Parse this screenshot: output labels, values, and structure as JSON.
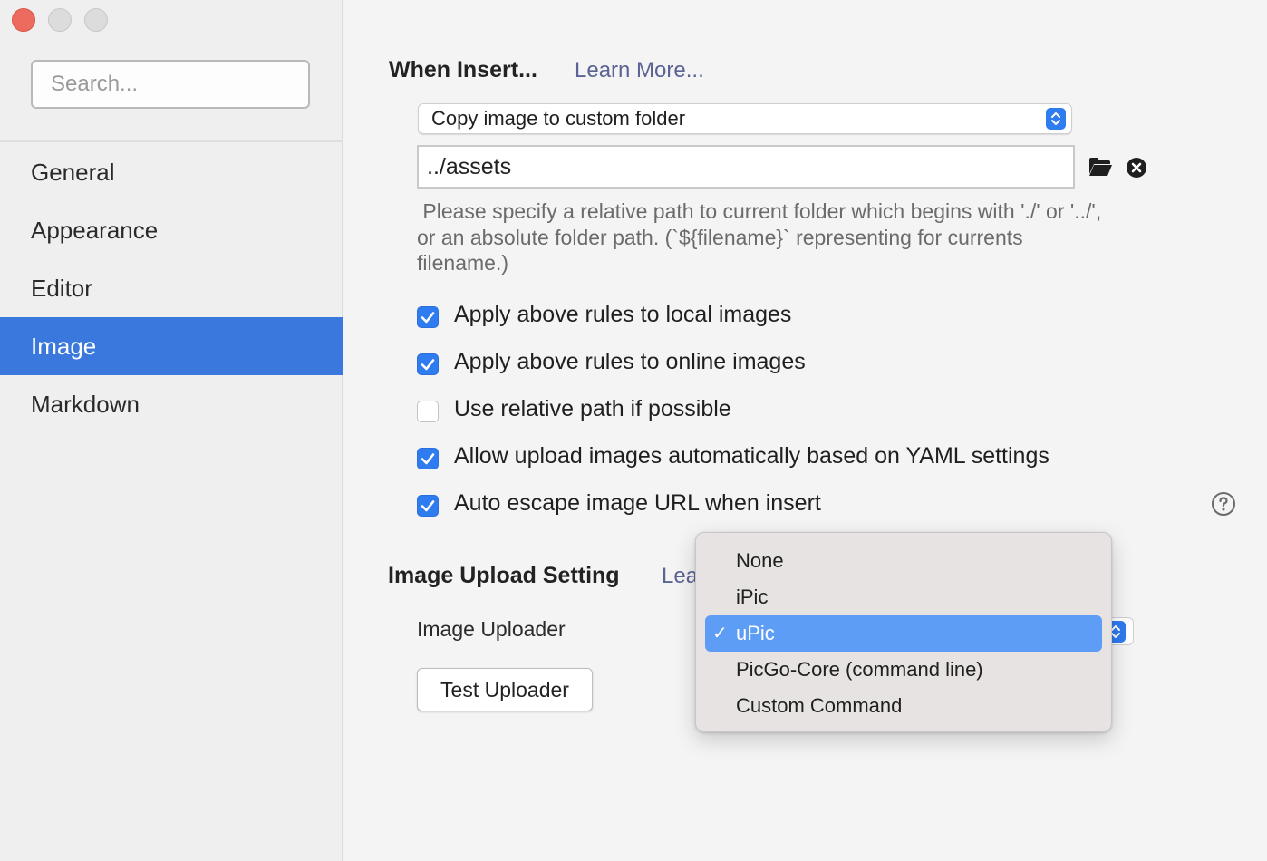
{
  "sidebar": {
    "search_placeholder": "Search...",
    "items": [
      {
        "label": "General"
      },
      {
        "label": "Appearance"
      },
      {
        "label": "Editor"
      },
      {
        "label": "Image",
        "active": true
      },
      {
        "label": "Markdown"
      }
    ]
  },
  "insert": {
    "title": "When Insert...",
    "learn_more": "Learn More...",
    "action_selected": "Copy image to custom folder",
    "folder_value": "../assets",
    "hint_line1": " Please specify a relative path to current folder which begins with './' or '../',",
    "hint_line2": "or an absolute folder path. (`${filename}` representing for currents",
    "hint_line3": "filename.)",
    "options": [
      {
        "label": "Apply above rules to local images",
        "checked": true
      },
      {
        "label": "Apply above rules to online images",
        "checked": true
      },
      {
        "label": "Use relative path if possible",
        "checked": false
      },
      {
        "label": "Allow upload images automatically based on YAML settings",
        "checked": true
      },
      {
        "label": "Auto escape image URL when insert",
        "checked": true
      }
    ]
  },
  "upload": {
    "title": "Image Upload Setting",
    "learn_more_partial": "Lea",
    "uploader_label": "Image Uploader",
    "test_button": "Test Uploader",
    "menu": {
      "options": [
        "None",
        "iPic",
        "uPic",
        "PicGo-Core (command line)",
        "Custom Command"
      ],
      "selected": "uPic",
      "check_mark": "✓"
    }
  },
  "colors": {
    "accent": "#3a78dd",
    "checkbox": "#2f7bf0",
    "menu_highlight": "#5e9df5",
    "close_button": "#ed6a5e",
    "link": "#5b6394"
  },
  "icons": [
    "folder-icon",
    "clear-circle-icon",
    "help-circle-icon",
    "popup-stepper-icon"
  ]
}
